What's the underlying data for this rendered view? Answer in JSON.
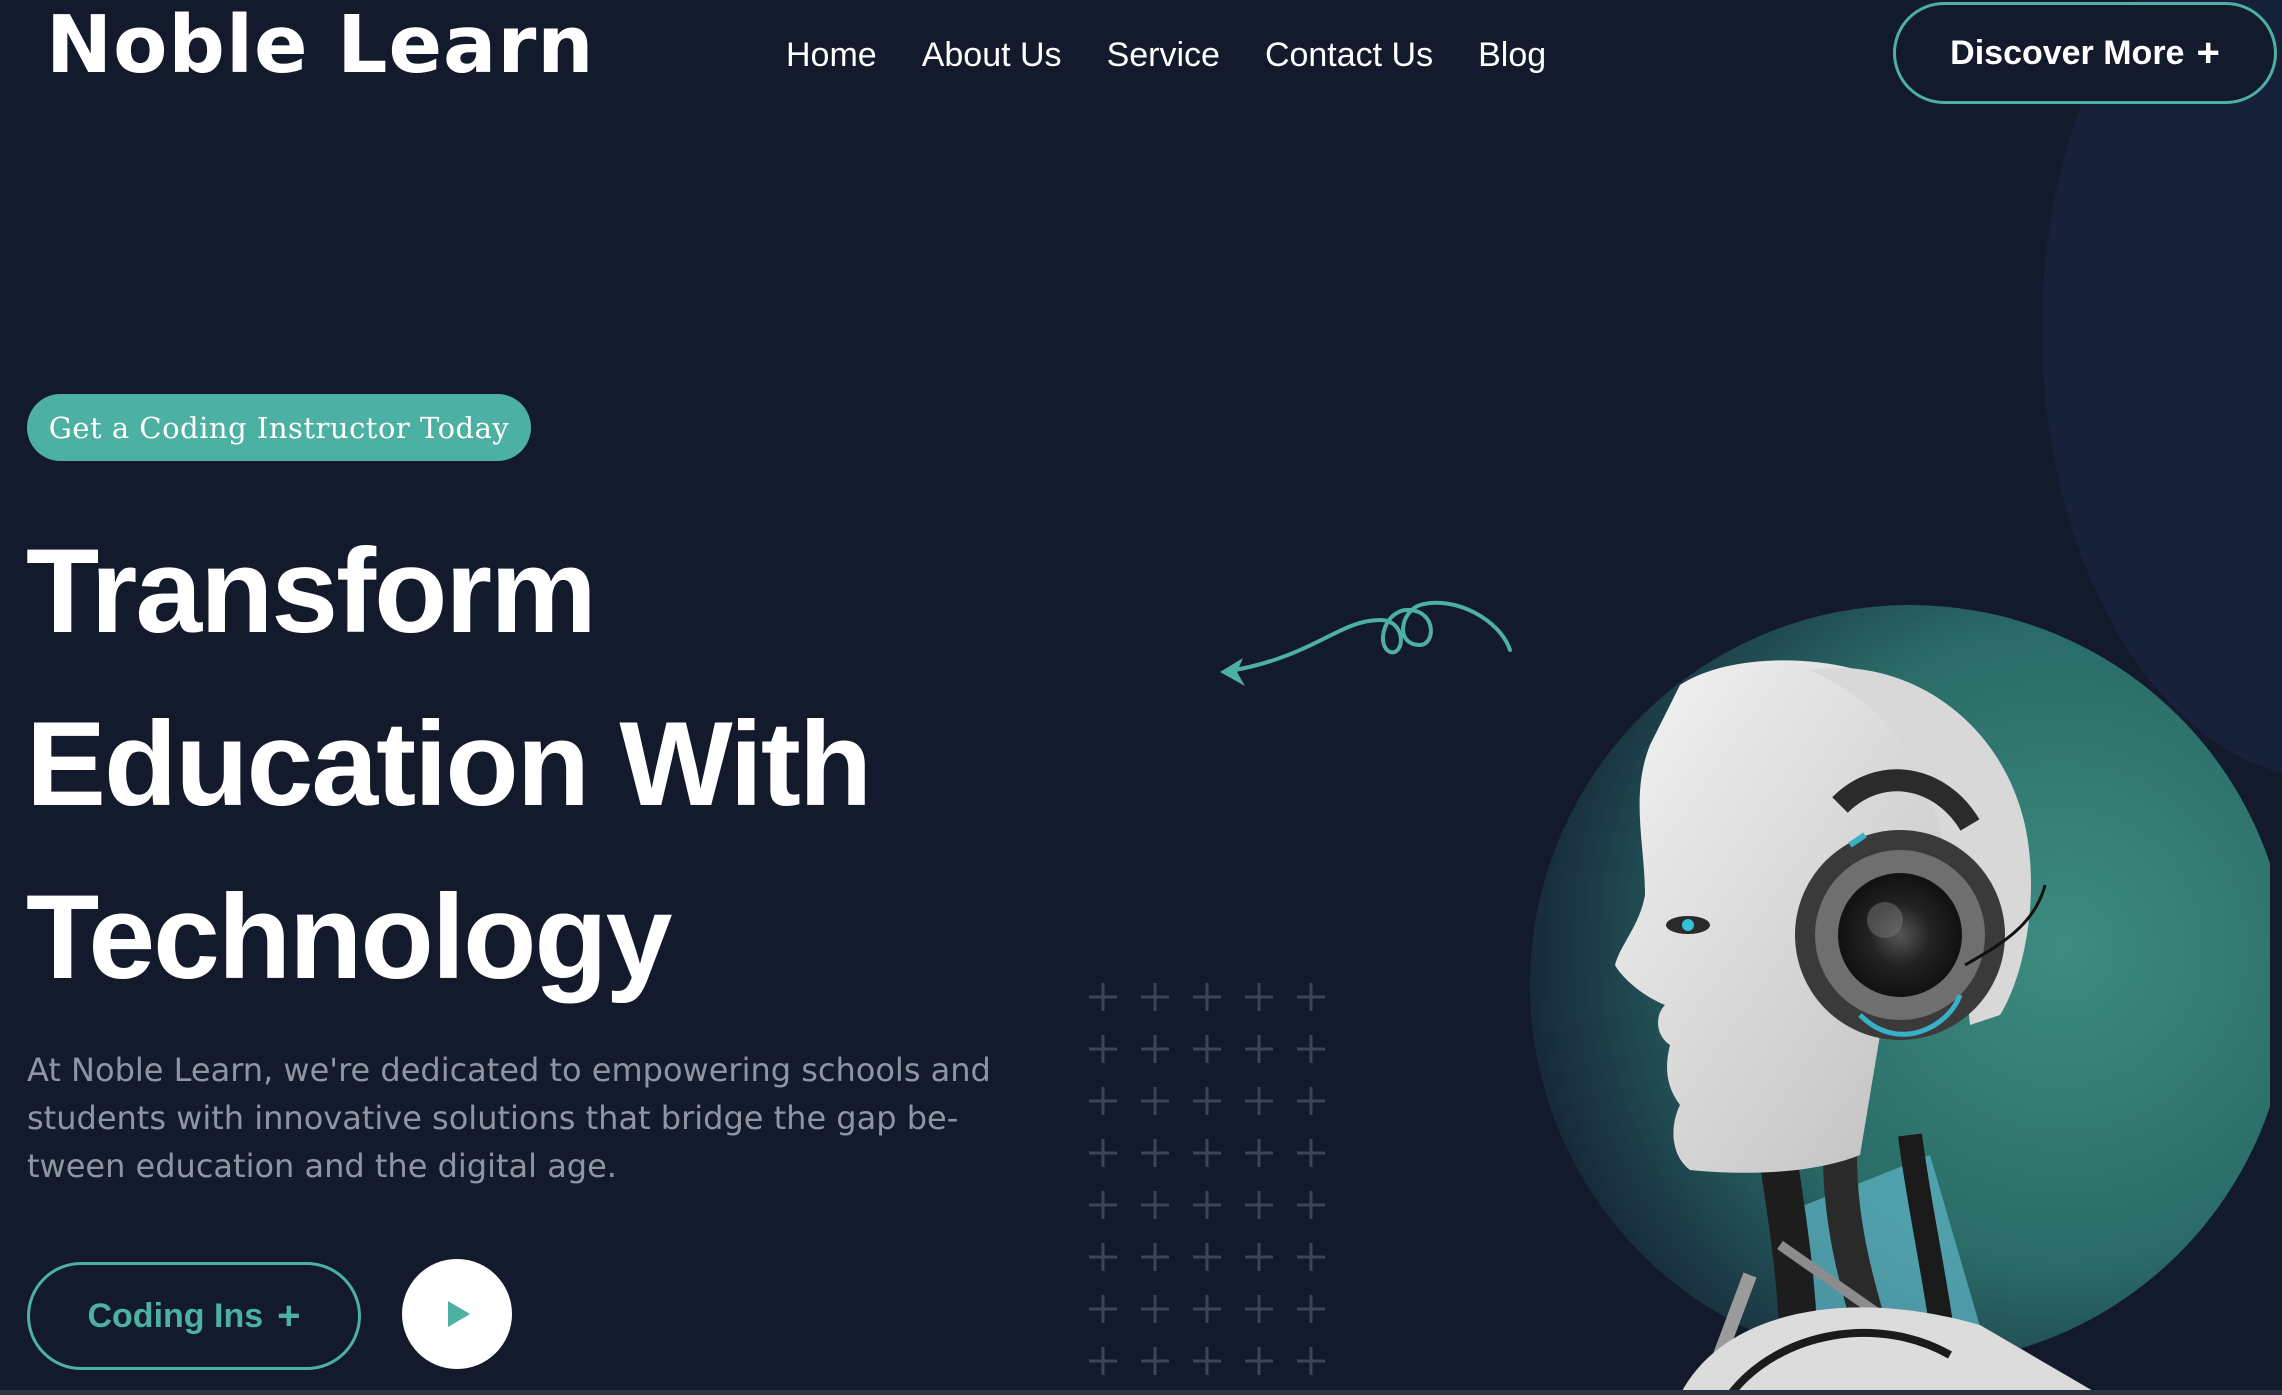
{
  "header": {
    "logo": "Noble Learn",
    "nav": [
      {
        "label": "Home"
      },
      {
        "label": "About Us"
      },
      {
        "label": "Service"
      },
      {
        "label": "Contact Us"
      },
      {
        "label": "Blog"
      }
    ],
    "cta_label": "Discover More",
    "cta_icon": "+"
  },
  "hero": {
    "badge": "Get a Coding Instructor Today",
    "headline_lines": [
      "Transform",
      "Education With",
      "Technology"
    ],
    "description": "At Noble Learn, we're dedicated to empowering schools and students with innovative solutions that bridge the gap be-tween education and the digital age.",
    "primary_button_label": "Coding Ins",
    "primary_button_icon": "+",
    "play_icon": "play-icon"
  },
  "colors": {
    "background": "#121a2b",
    "accent": "#4cb1a2",
    "muted_text": "#8f96a3",
    "text": "#ffffff"
  }
}
